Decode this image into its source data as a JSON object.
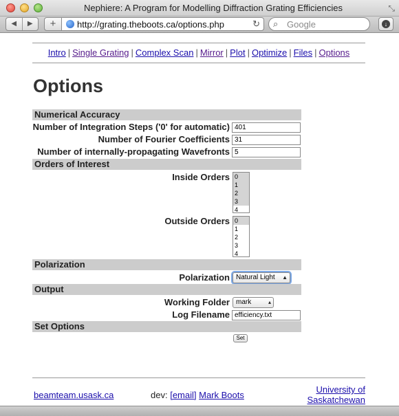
{
  "window": {
    "title": "Nephiere: A Program for Modelling Diffraction Grating Efficiencies"
  },
  "browser": {
    "url": "http://grating.theboots.ca/options.php",
    "search_placeholder": "Google",
    "back_glyph": "◀",
    "forward_glyph": "▶",
    "add_glyph": "+",
    "reload_glyph": "↻",
    "search_glyph": "⌕",
    "download_glyph": "↓",
    "resize_glyph": "⤡"
  },
  "nav": {
    "links": [
      {
        "label": "Intro"
      },
      {
        "label": "Single Grating"
      },
      {
        "label": "Complex Scan"
      },
      {
        "label": "Mirror"
      },
      {
        "label": "Plot"
      },
      {
        "label": "Optimize"
      },
      {
        "label": "Files"
      },
      {
        "label": "Options"
      }
    ],
    "separator": "|"
  },
  "page": {
    "title": "Options"
  },
  "sections": {
    "numerical": "Numerical Accuracy",
    "orders": "Orders of Interest",
    "polarization": "Polarization",
    "output": "Output",
    "set": "Set Options"
  },
  "fields": {
    "integration_steps": {
      "label": "Number of Integration Steps ('0' for automatic)",
      "value": "401"
    },
    "fourier": {
      "label": "Number of Fourier Coefficients",
      "value": "31"
    },
    "wavefronts": {
      "label": "Number of internally-propagating Wavefronts",
      "value": "5"
    },
    "inside_orders": {
      "label": "Inside Orders",
      "options": [
        "0",
        "1",
        "2",
        "3",
        "4"
      ]
    },
    "outside_orders": {
      "label": "Outside Orders",
      "options": [
        "0",
        "1",
        "2",
        "3",
        "4"
      ]
    },
    "polarization": {
      "label": "Polarization",
      "value": "Natural Light"
    },
    "working_folder": {
      "label": "Working Folder",
      "value": "mark"
    },
    "log_filename": {
      "label": "Log Filename",
      "value": "efficiency.txt"
    },
    "set_button": "Set"
  },
  "footer": {
    "site": "beamteam.usask.ca",
    "dev_label": "dev:",
    "email": "[email]",
    "author": "Mark Boots",
    "university_line1": "University of",
    "university_line2": "Saskatchewan"
  }
}
